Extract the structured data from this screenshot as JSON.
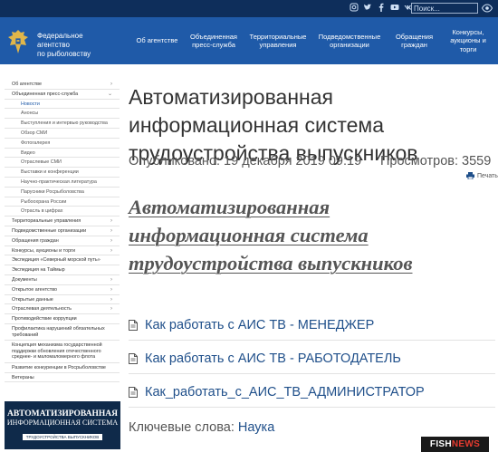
{
  "topbar": {
    "social_icons": [
      "instagram-icon",
      "twitter-icon",
      "facebook-icon",
      "youtube-icon",
      "vk-icon"
    ],
    "search_placeholder": "Поиск...",
    "accessibility_icon": "eye-icon"
  },
  "header": {
    "agency_name": "Федеральное\nагентство\nпо рыболовству",
    "nav": [
      "Об агентстве",
      "Объединенная\nпресс-служба",
      "Территориальные\nуправления",
      "Подведомственные\nорганизации",
      "Обращения\nграждан",
      "Конкурсы,\nаукционы и\nторги"
    ]
  },
  "sidebar": {
    "items": [
      {
        "label": "Об агентстве",
        "chevron": "›"
      },
      {
        "label": "Объединенная пресс-служба",
        "chevron": "⌄"
      },
      {
        "label": "Новости"
      },
      {
        "label": "Анонсы"
      },
      {
        "label": "Выступления и интервью руководства"
      },
      {
        "label": "Обзор СМИ"
      },
      {
        "label": "Фотогалерея"
      },
      {
        "label": "Видео"
      },
      {
        "label": "Отраслевые СМИ"
      },
      {
        "label": "Выставки и конференции"
      },
      {
        "label": "Научно-практическая литература"
      },
      {
        "label": "Парусники Росрыболовства"
      },
      {
        "label": "Рыбоохрана России"
      },
      {
        "label": "Отрасль в цифрах"
      },
      {
        "label": "Территориальные управления",
        "chevron": "›"
      },
      {
        "label": "Подведомственные организации",
        "chevron": "›"
      },
      {
        "label": "Обращения граждан",
        "chevron": "›"
      },
      {
        "label": "Конкурсы, аукционы и торги",
        "chevron": "›"
      },
      {
        "label": "Экспедиция «Северный морской путь»"
      },
      {
        "label": "Экспедиция на Таймыр"
      },
      {
        "label": "Документы",
        "chevron": "›"
      },
      {
        "label": "Открытое агентство",
        "chevron": "›"
      },
      {
        "label": "Открытые данные",
        "chevron": "›"
      },
      {
        "label": "Отраслевая деятельность",
        "chevron": "›"
      },
      {
        "label": "Противодействие коррупции"
      },
      {
        "label": "Профилактика нарушений обязательных\nтребований"
      },
      {
        "label": "Концепция механизма государственной\nподдержки обновления отечественного\nсреднее- и маломаломерного флота"
      },
      {
        "label": "Развитие конкуренции в Росрыболовстве"
      },
      {
        "label": "Ветераны"
      }
    ]
  },
  "banner": {
    "line1": "АВТОМАТИЗИРОВАННАЯ",
    "line2": "ИНФОРМАЦИОННАЯ СИСТЕМА",
    "line3": "ТРУДОУСТРОЙСТВА ВЫПУСКНИКОВ"
  },
  "main": {
    "title": "Автоматизированная информационная система трудоустройства выпускников",
    "published": "Опубликовано: 19 декабря 2019 09:19",
    "views": "Просмотров: 3559",
    "print_label": "Печать",
    "subtitle": "Автоматизированная информационная система трудоустройства выпускников",
    "documents": [
      "Как работать с АИС ТВ - МЕНЕДЖЕР",
      "Как работать с АИС ТВ - РАБОТОДАТЕЛЬ",
      "Как_работать_с_АИС_ТВ_АДМИНИСТРАТОР"
    ],
    "keywords_label": "Ключевые слова:",
    "keyword": "Наука"
  },
  "watermark": {
    "part1": "FISH",
    "part2": "NEWS"
  },
  "colors": {
    "topbar": "#0e2e5b",
    "header": "#1f5aa8",
    "link": "#1f4f8a",
    "accent_red": "#e53a2f"
  }
}
